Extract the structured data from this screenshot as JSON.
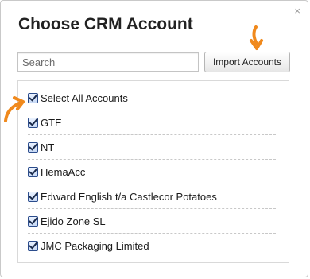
{
  "dialog": {
    "title": "Choose CRM Account",
    "close_glyph": "×"
  },
  "search": {
    "placeholder": "Search",
    "value": ""
  },
  "toolbar": {
    "import_label": "Import Accounts"
  },
  "accounts": {
    "select_all_label": "Select All Accounts",
    "items": [
      {
        "label": "GTE",
        "checked": true
      },
      {
        "label": "NT",
        "checked": true
      },
      {
        "label": "HemaAcc",
        "checked": true
      },
      {
        "label": "Edward English t/a Castlecor Potatoes",
        "checked": true
      },
      {
        "label": "Ejido Zone SL",
        "checked": true
      },
      {
        "label": "JMC Packaging Limited",
        "checked": true
      }
    ]
  },
  "colors": {
    "annotation_arrow": "#f0891c",
    "checkbox_border": "#2b4c8c"
  },
  "icons": {
    "import_pointer": "curved-arrow-down-icon",
    "select_all_pointer": "curved-arrow-right-icon"
  }
}
